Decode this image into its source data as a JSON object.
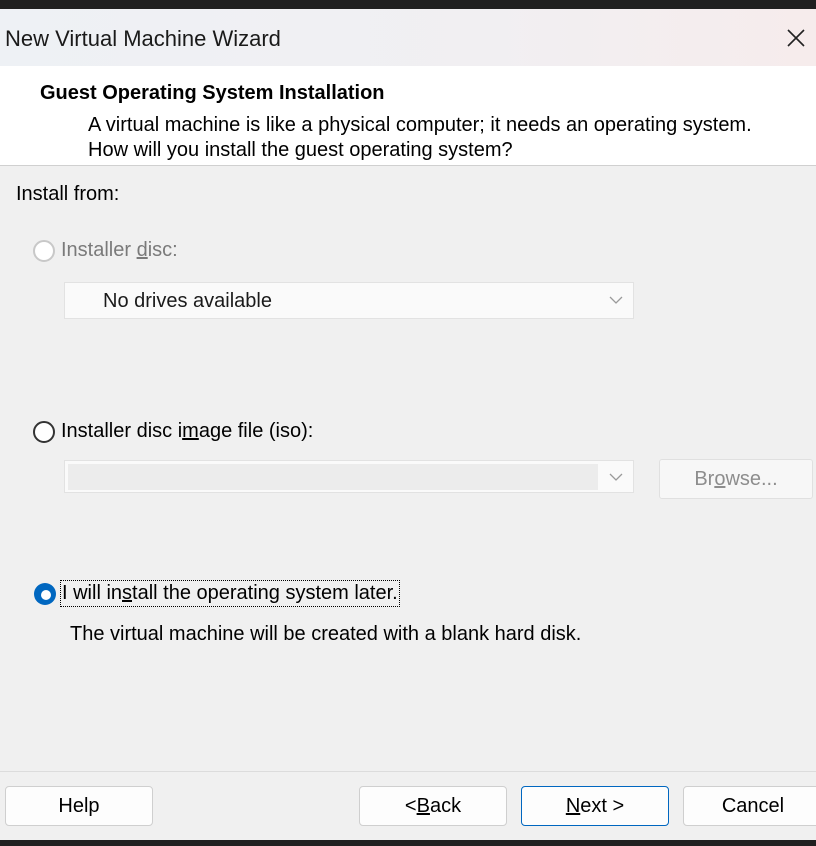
{
  "window": {
    "title": "New Virtual Machine Wizard",
    "close_icon": "close-icon"
  },
  "header": {
    "title": "Guest Operating System Installation",
    "description": "A virtual machine is like a physical computer; it needs an operating system. How will you install the guest operating system?"
  },
  "install_from_label": "Install from:",
  "options": {
    "installer_disc": {
      "label_pre": "Installer ",
      "label_mnemonic": "d",
      "label_post": "isc:",
      "enabled": false,
      "selected": false,
      "dropdown_value": "No drives available"
    },
    "iso": {
      "label_pre": "Installer disc i",
      "label_mnemonic": "m",
      "label_post": "age file (iso):",
      "enabled": true,
      "selected": false,
      "path_value": "",
      "browse_pre": "Br",
      "browse_mnemonic": "o",
      "browse_post": "wse..."
    },
    "later": {
      "label_pre": "I will in",
      "label_mnemonic": "s",
      "label_post": "tall the operating system later.",
      "enabled": true,
      "selected": true,
      "description": "The virtual machine will be created with a blank hard disk."
    }
  },
  "buttons": {
    "help": "Help",
    "back_pre": "< ",
    "back_mnemonic": "B",
    "back_post": "ack",
    "next_mnemonic": "N",
    "next_post": "ext >",
    "cancel": "Cancel"
  },
  "colors": {
    "accent": "#0067c0",
    "disabled_text": "#7a7a7a"
  }
}
